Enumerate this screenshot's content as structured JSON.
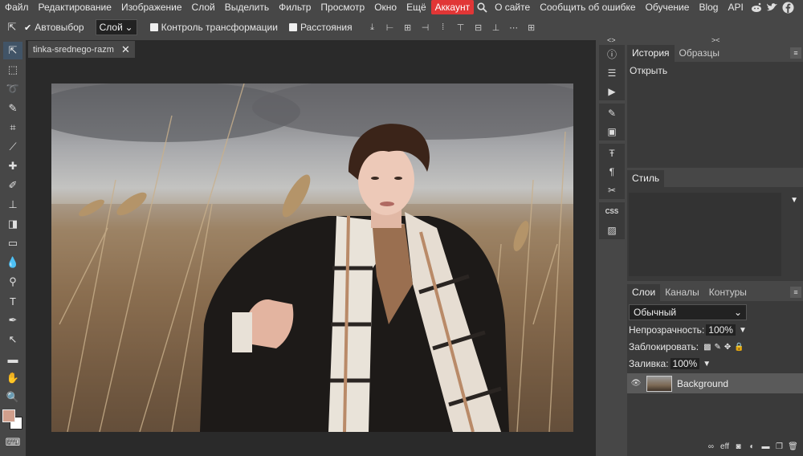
{
  "menu": {
    "items": [
      "Файл",
      "Редактирование",
      "Изображение",
      "Слой",
      "Выделить",
      "Фильтр",
      "Просмотр",
      "Окно",
      "Ещё"
    ],
    "account": "Аккаунт",
    "links": [
      "О сайте",
      "Сообщить об ошибке",
      "Обучение",
      "Blog",
      "API"
    ],
    "icons": [
      "search-icon",
      "reddit-icon",
      "twitter-icon",
      "facebook-icon"
    ]
  },
  "options": {
    "autoselect_label": "Автовыбор",
    "autoselect_target": "Слой",
    "transform_controls_label": "Контроль трансформации",
    "distances_label": "Расстояния"
  },
  "document": {
    "tab_name": "tinka-srednego-razm",
    "image_description_icon": "photo"
  },
  "panels": {
    "history": {
      "tabs": [
        "История",
        "Образцы"
      ],
      "entries": [
        "Открыть"
      ]
    },
    "style": {
      "title": "Стиль"
    },
    "layers": {
      "tabs": [
        "Слои",
        "Каналы",
        "Контуры"
      ],
      "blend_mode": "Обычный",
      "opacity_label": "Непрозрачность:",
      "opacity_value": "100%",
      "lock_label": "Заблокировать:",
      "fill_label": "Заливка:",
      "fill_value": "100%",
      "layer_name": "Background"
    }
  },
  "colors": {
    "foreground": "#d19f8c",
    "background": "#ffffff",
    "accent": "#e13636"
  }
}
